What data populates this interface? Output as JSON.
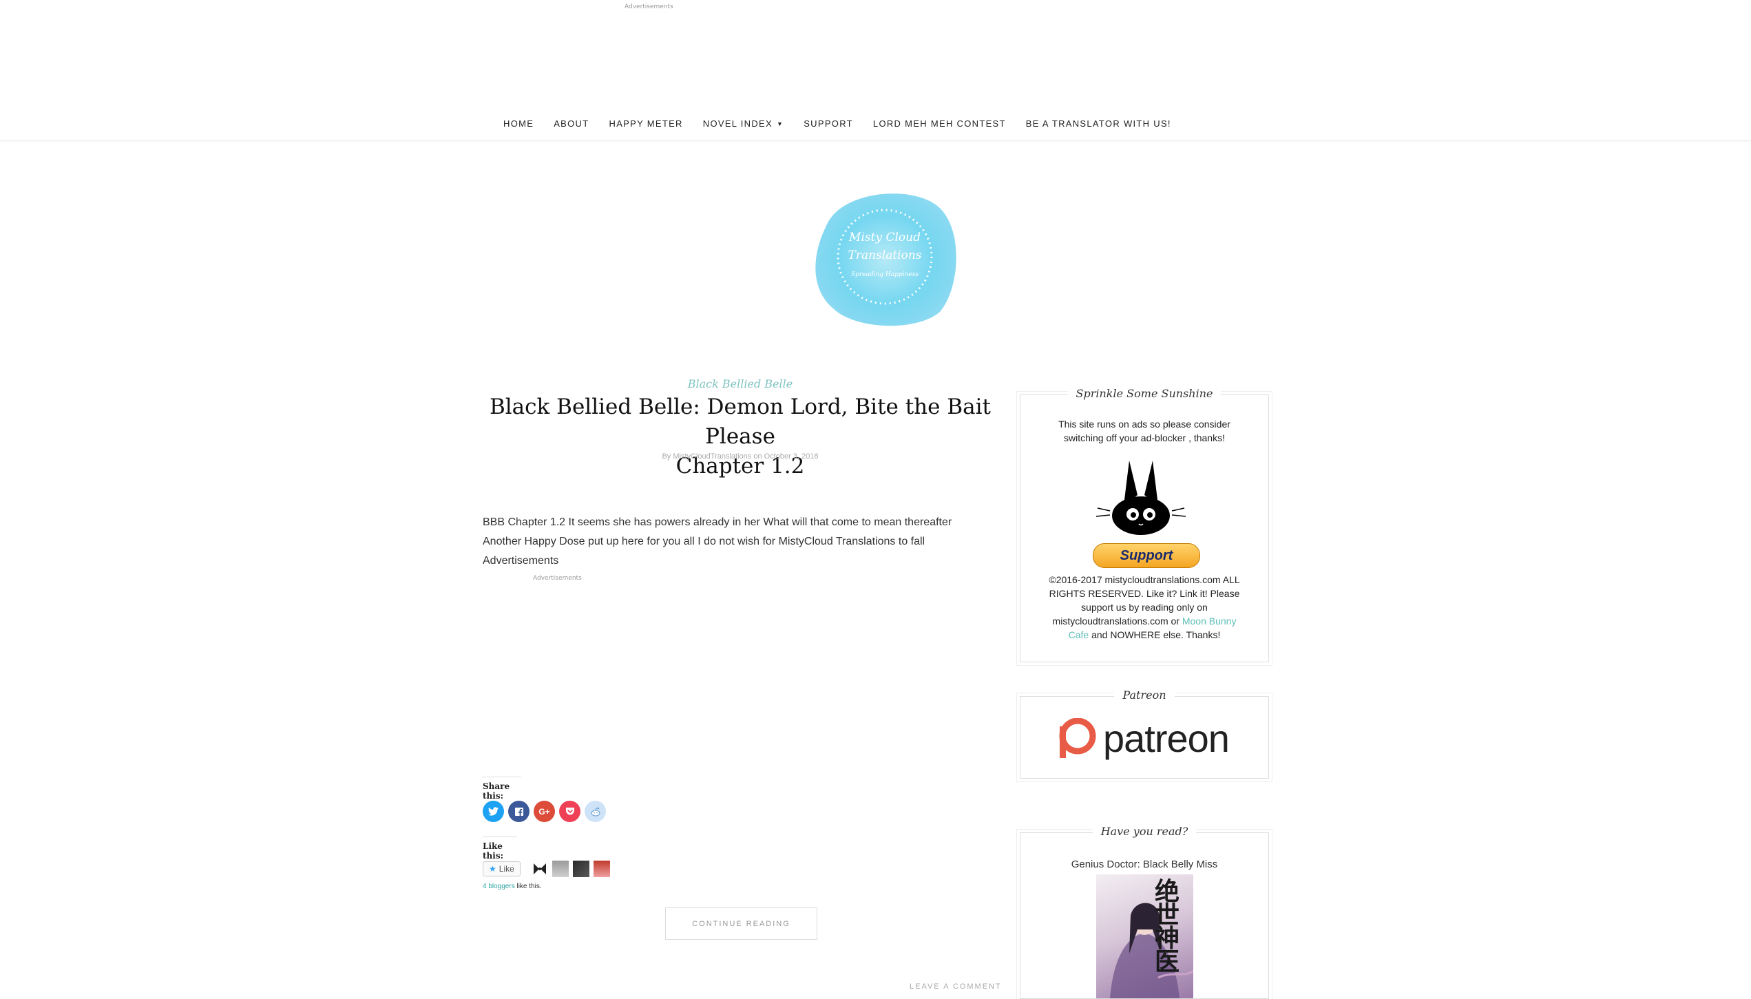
{
  "top_ad": {
    "label": "Advertisements"
  },
  "nav": {
    "items": [
      "HOME",
      "ABOUT",
      "HAPPY METER",
      "NOVEL INDEX",
      "SUPPORT",
      "LORD MEH MEH CONTEST",
      "BE A TRANSLATOR WITH US!"
    ]
  },
  "logo": {
    "line1": "Misty Cloud",
    "line2": "Translations",
    "line3": "Spreading Happiness"
  },
  "post": {
    "category": "Black Bellied Belle",
    "title_line1": "Black Bellied Belle: Demon Lord, Bite the Bait Please",
    "title_line2": "Chapter 1.2",
    "meta_by": "By",
    "meta_author": "MistyCloudTranslations",
    "meta_on": "on",
    "meta_date": "October 3, 2018",
    "excerpt": "BBB Chapter 1.2   It seems she has powers already in her What will that come to mean thereafter Another Happy Dose put up here for you all I do not wish for MistyCloud Translations to fall Advertisements",
    "inline_ad": "Advertisements",
    "share_label": "Share this:",
    "like_label": "Like this:",
    "like_button": "Like",
    "bloggers_count": "4 bloggers",
    "bloggers_suffix": "like this.",
    "continue_reading": "CONTINUE READING",
    "leave_comment": "LEAVE A COMMENT"
  },
  "share_buttons": [
    {
      "name": "twitter",
      "glyph": "t",
      "color": "#1da1f2"
    },
    {
      "name": "facebook",
      "glyph": "f",
      "color": "#3b5998"
    },
    {
      "name": "google-plus",
      "glyph": "G+",
      "color": "#dd4b39"
    },
    {
      "name": "pocket",
      "glyph": "✓",
      "color": "#ef4056"
    },
    {
      "name": "reddit",
      "glyph": "r",
      "color": "#cee3f8"
    }
  ],
  "sidebar": {
    "sunshine": {
      "title": "Sprinkle Some Sunshine",
      "note": "This site runs on ads so please consider switching off your ad-blocker , thanks!",
      "support_button": "Support",
      "copyright_pre": "©2016-2017 mistycloudtranslations.com ALL RIGHTS RESERVED. Like it? Link it! Please support us by reading only on mistycloudtranslations.com or",
      "copyright_link": "Moon Bunny Cafe",
      "copyright_post": "and NOWHERE else. Thanks!"
    },
    "patreon": {
      "title": "Patreon",
      "logo_text": "patreon",
      "brand_color": "#e85b46"
    },
    "have_you_read": {
      "title": "Have you read?",
      "book_title": "Genius Doctor: Black Belly Miss",
      "cover_chars": "绝世神医"
    }
  }
}
